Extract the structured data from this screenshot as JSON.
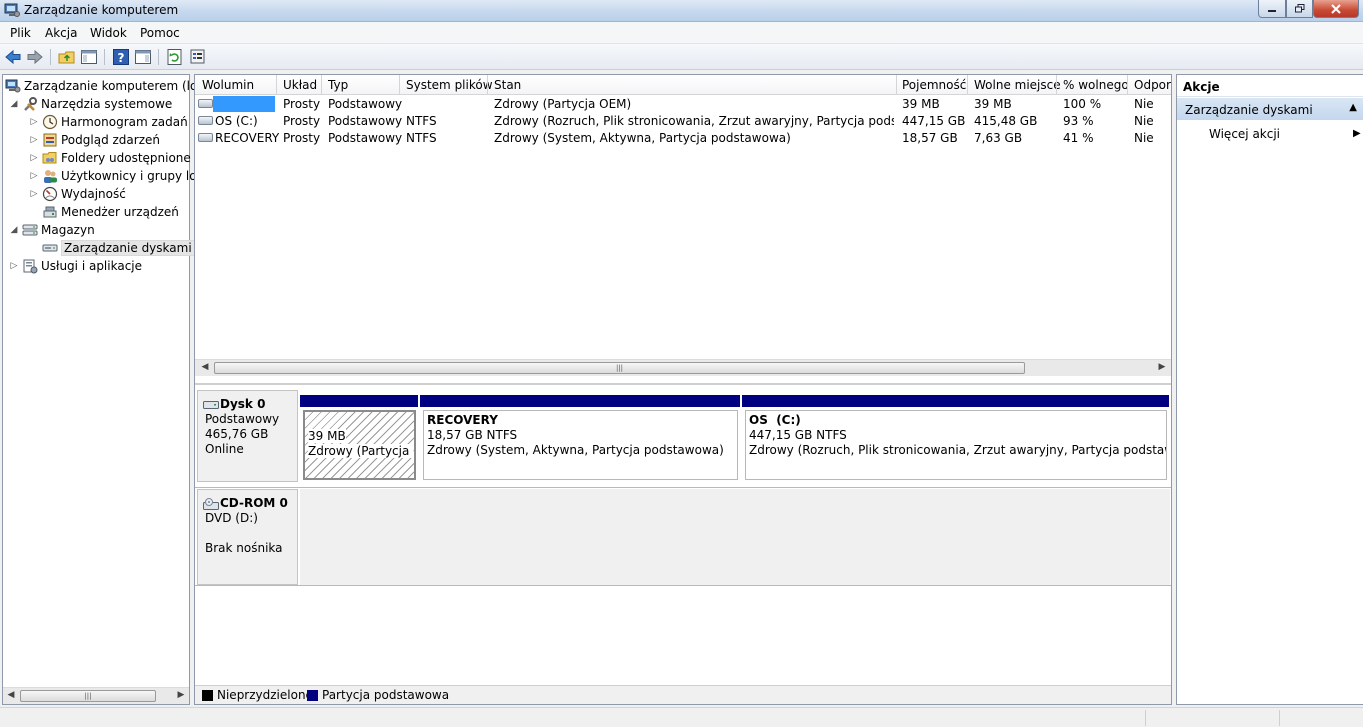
{
  "window": {
    "title": "Zarządzanie komputerem"
  },
  "menu": [
    "Plik",
    "Akcja",
    "Widok",
    "Pomoc"
  ],
  "tree": {
    "root": "Zarządzanie komputerem (loka",
    "system_tools": "Narzędzia systemowe",
    "task_scheduler": "Harmonogram zadań",
    "event_viewer": "Podgląd zdarzeń",
    "shared_folders": "Foldery udostępnione",
    "users_groups": "Użytkownicy i grupy lok",
    "performance": "Wydajność",
    "device_manager": "Menedżer urządzeń",
    "storage": "Magazyn",
    "disk_management": "Zarządzanie dyskami",
    "services_apps": "Usługi i aplikacje"
  },
  "columns": [
    "Wolumin",
    "Układ",
    "Typ",
    "System plików",
    "Stan",
    "Pojemność",
    "Wolne miejsce",
    "% wolnego",
    "Odpor"
  ],
  "volumes": [
    {
      "name": "",
      "layout": "Prosty",
      "type": "Podstawowy",
      "fs": "",
      "status": "Zdrowy (Partycja OEM)",
      "capacity": "39 MB",
      "free": "39 MB",
      "pct": "100 %",
      "fault": "Nie"
    },
    {
      "name": "OS (C:)",
      "layout": "Prosty",
      "type": "Podstawowy",
      "fs": "NTFS",
      "status": "Zdrowy (Rozruch, Plik stronicowania, Zrzut awaryjny, Partycja podstawowa)",
      "capacity": "447,15 GB",
      "free": "415,48 GB",
      "pct": "93 %",
      "fault": "Nie"
    },
    {
      "name": "RECOVERY",
      "layout": "Prosty",
      "type": "Podstawowy",
      "fs": "NTFS",
      "status": "Zdrowy (System, Aktywna, Partycja podstawowa)",
      "capacity": "18,57 GB",
      "free": "7,63 GB",
      "pct": "41 %",
      "fault": "Nie"
    }
  ],
  "disk0": {
    "title": "Dysk 0",
    "type": "Podstawowy",
    "size": "465,76 GB",
    "state": "Online",
    "p1": {
      "size": "39 MB",
      "status": "Zdrowy (Partycja OE"
    },
    "p2": {
      "name": "RECOVERY",
      "size": "18,57 GB NTFS",
      "status": "Zdrowy (System, Aktywna, Partycja podstawowa)"
    },
    "p3": {
      "name": "OS  (C:)",
      "size": "447,15 GB NTFS",
      "status": "Zdrowy (Rozruch, Plik stronicowania, Zrzut awaryjny, Partycja podstawowa)"
    }
  },
  "cdrom0": {
    "title": "CD-ROM 0",
    "drive": "DVD (D:)",
    "media": "Brak nośnika"
  },
  "legend": {
    "unallocated": "Nieprzydzielone",
    "primary": "Partycja podstawowa",
    "unallocated_color": "#000000",
    "primary_color": "#000080"
  },
  "actions": {
    "header": "Akcje",
    "section": "Zarządzanie dyskami",
    "more": "Więcej akcji"
  },
  "colors": {
    "selection": "#3399ff",
    "partition_bar": "#000080",
    "actions_section": "#c4d7ee"
  }
}
